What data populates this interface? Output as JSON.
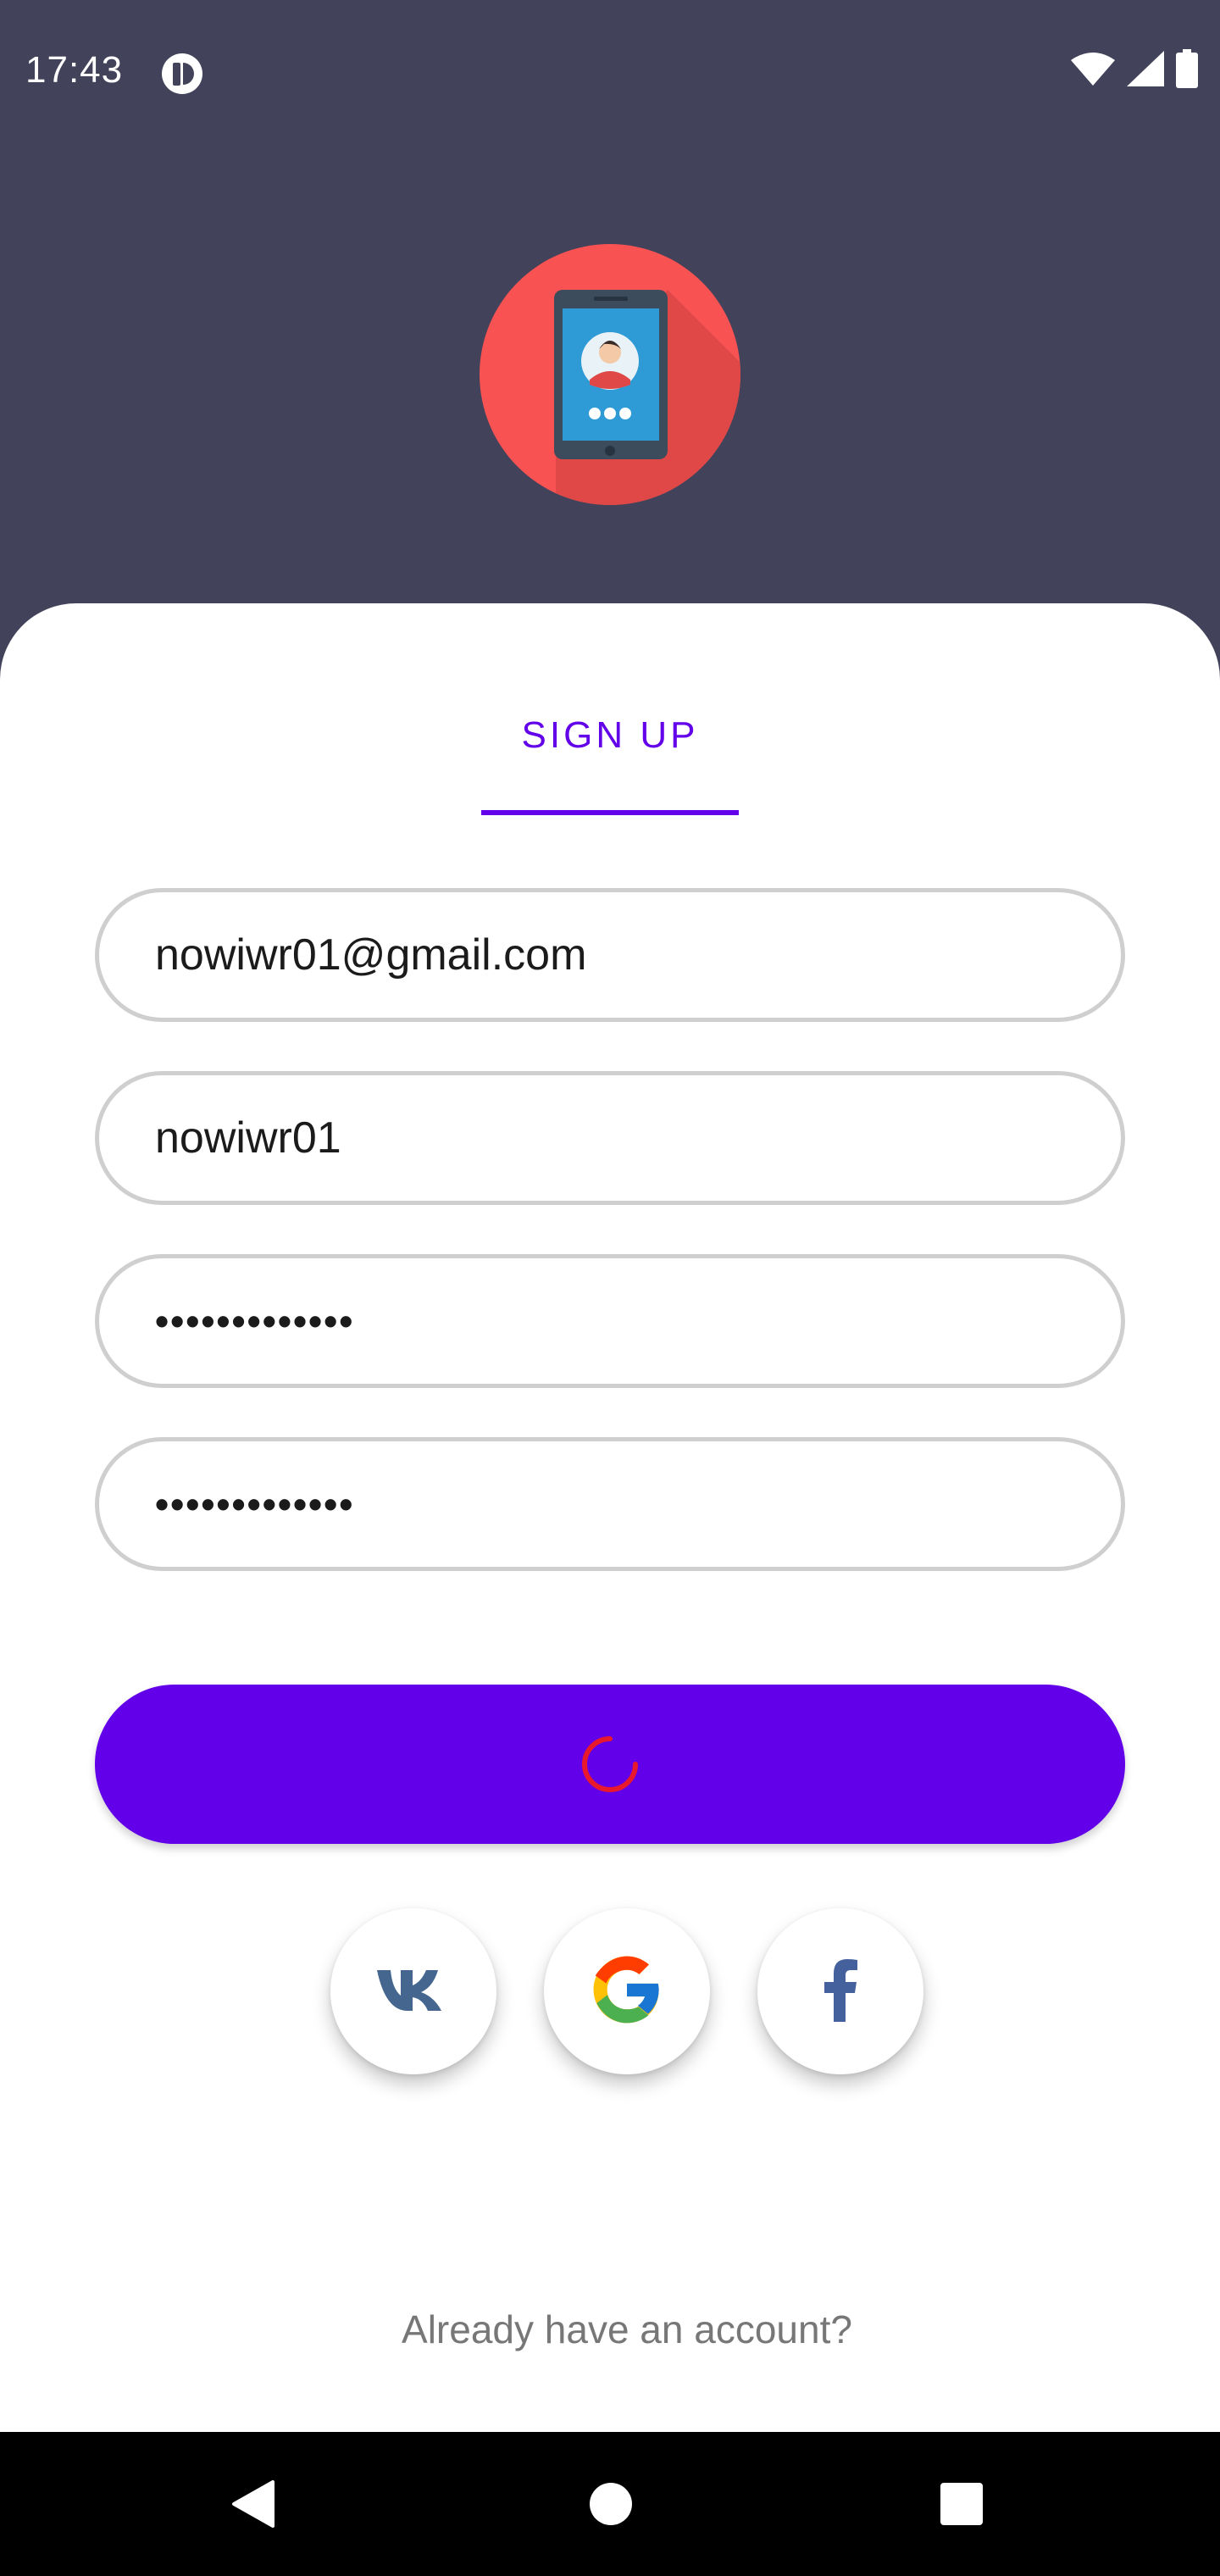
{
  "status_bar": {
    "time": "17:43",
    "icons": [
      "notification-icon",
      "wifi-icon",
      "cell-signal-icon",
      "battery-icon"
    ]
  },
  "header": {
    "logo_icon": "phone-contact-icon"
  },
  "form": {
    "tab_label": "SIGN UP",
    "email_value": "nowiwr01@gmail.com",
    "username_value": "nowiwr01",
    "password_value": "•••••••••••••",
    "confirm_password_value": "•••••••••••••",
    "submit_state": "loading"
  },
  "social": [
    "vk-icon",
    "google-icon",
    "facebook-icon"
  ],
  "footer": {
    "login_link": "Already have an account?"
  },
  "colors": {
    "background": "#42435a",
    "accent": "#6200ea",
    "logo_circle": "#f85252",
    "spinner": "#e8192c"
  }
}
